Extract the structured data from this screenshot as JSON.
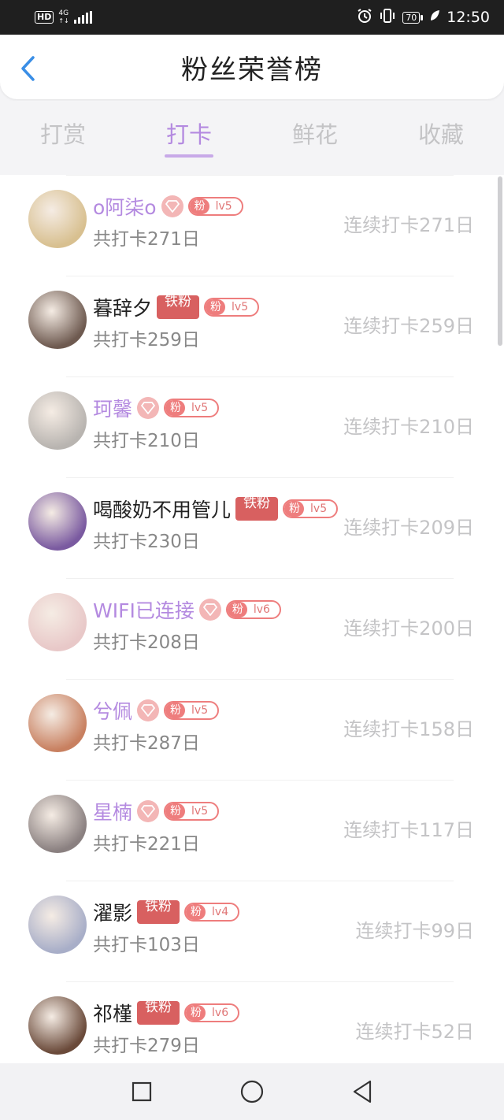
{
  "status_bar": {
    "hd": "HD",
    "network": "4G",
    "battery": "70",
    "time": "12:50"
  },
  "header": {
    "title": "粉丝荣誉榜"
  },
  "tabs": [
    {
      "label": "打赏",
      "active": false
    },
    {
      "label": "打卡",
      "active": true
    },
    {
      "label": "鲜花",
      "active": false
    },
    {
      "label": "收藏",
      "active": false
    }
  ],
  "fans": [
    {
      "name": "o阿柒o",
      "vip": true,
      "badge": "diamond",
      "fan_tag": "粉",
      "level": "lv5",
      "total": "共打卡271日",
      "streak": "连续打卡271日",
      "avatar_color": "#d8c090"
    },
    {
      "name": "暮辞夕",
      "vip": false,
      "badge": "铁粉",
      "fan_tag": "粉",
      "level": "lv5",
      "total": "共打卡259日",
      "streak": "连续打卡259日",
      "avatar_color": "#6e5a50"
    },
    {
      "name": "珂馨",
      "vip": true,
      "badge": "diamond",
      "fan_tag": "粉",
      "level": "lv5",
      "total": "共打卡210日",
      "streak": "连续打卡210日",
      "avatar_color": "#b8b4b0"
    },
    {
      "name": "喝酸奶不用管儿",
      "vip": false,
      "badge": "铁粉",
      "fan_tag": "粉",
      "level": "lv5",
      "total": "共打卡230日",
      "streak": "连续打卡209日",
      "avatar_color": "#7a5aa0"
    },
    {
      "name": "WIFI已连接",
      "vip": true,
      "badge": "diamond",
      "fan_tag": "粉",
      "level": "lv6",
      "total": "共打卡208日",
      "streak": "连续打卡200日",
      "avatar_color": "#e8c8c8"
    },
    {
      "name": "兮佩",
      "vip": true,
      "badge": "diamond",
      "fan_tag": "粉",
      "level": "lv5",
      "total": "共打卡287日",
      "streak": "连续打卡158日",
      "avatar_color": "#c88060"
    },
    {
      "name": "星楠",
      "vip": true,
      "badge": "diamond",
      "fan_tag": "粉",
      "level": "lv5",
      "total": "共打卡221日",
      "streak": "连续打卡117日",
      "avatar_color": "#8a8080"
    },
    {
      "name": "濯影",
      "vip": false,
      "badge": "铁粉",
      "fan_tag": "粉",
      "level": "lv4",
      "total": "共打卡103日",
      "streak": "连续打卡99日",
      "avatar_color": "#a8aec8"
    },
    {
      "name": "祁槿",
      "vip": false,
      "badge": "铁粉",
      "fan_tag": "粉",
      "level": "lv6",
      "total": "共打卡279日",
      "streak": "连续打卡52日",
      "avatar_color": "#6a4a3a"
    }
  ],
  "icons": {
    "back": "chevron-left-icon",
    "nav": [
      "square-icon",
      "circle-icon",
      "triangle-back-icon"
    ]
  },
  "colors": {
    "accent": "#b48ae0",
    "badge_red": "#ee7d7d",
    "back_blue": "#3a8ee6"
  }
}
